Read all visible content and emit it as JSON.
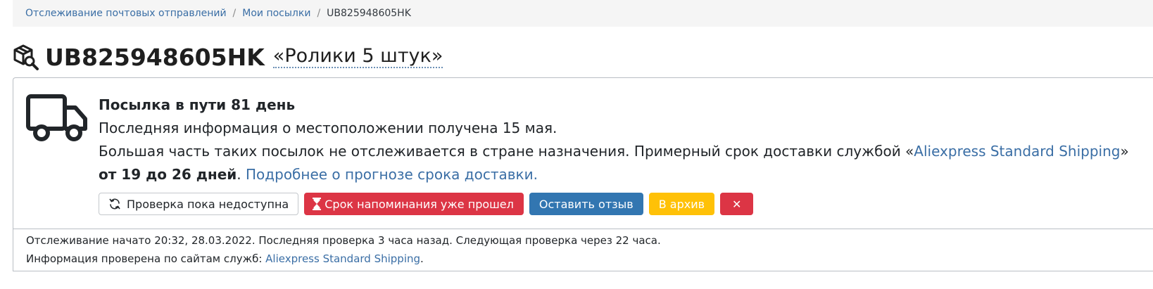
{
  "breadcrumb": {
    "items": [
      "Отслеживание почтовых отправлений",
      "Мои посылки"
    ],
    "separator": "/",
    "current": "UB825948605HK"
  },
  "header": {
    "icon": "package-search-icon",
    "tracking_number": "UB825948605HK",
    "parcel_name": "«Ролики 5 штук»"
  },
  "status": {
    "icon": "truck-icon",
    "title": "Посылка в пути 81 день",
    "line1": "Последняя информация о местоположении получена 15 мая.",
    "line2_prefix": "Большая часть таких посылок не отслеживается в стране назначения. Примерный срок доставки службой «",
    "service_link": "Aliexpress Standard Shipping",
    "line2_suffix": "»",
    "estimate_bold": "от 19 до 26 дней",
    "estimate_punct": ". ",
    "forecast_link": "Подробнее о прогнозе срока доставки."
  },
  "buttons": {
    "check": "Проверка пока недоступна",
    "reminder": "Срок напоминания уже прошел",
    "review": "Оставить отзыв",
    "archive": "В архив",
    "delete": "✕"
  },
  "footer": {
    "line1": "Отслеживание начато 20:32, 28.03.2022. Последняя проверка 3 часа назад. Следующая проверка через 22 часа.",
    "line2_prefix": "Информация проверена по сайтам служб: ",
    "line2_link": "Aliexpress Standard Shipping",
    "line2_suffix": "."
  },
  "colors": {
    "link": "#3a6ea5",
    "danger": "#dc3545",
    "primary": "#3276b1",
    "warning": "#ffc107"
  }
}
